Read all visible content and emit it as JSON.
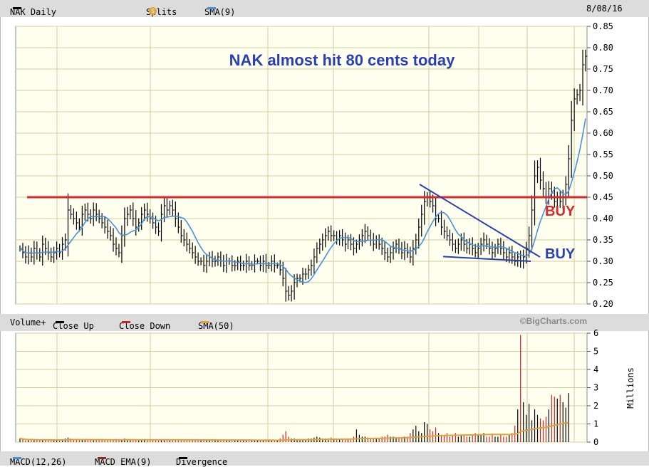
{
  "price_header": {
    "symbol_label": "NAK Daily",
    "splits_label": "Splits",
    "splits_icon": "S",
    "sma_label": "SMA(9)",
    "date_label": "8/08/16"
  },
  "volume_header": {
    "volume_label": "Volume+",
    "close_up_label": "Close Up",
    "close_down_label": "Close Down",
    "sma_label": "SMA(50)"
  },
  "macd_header": {
    "macd_label": "MACD(12,26)",
    "ema_label": "MACD EMA(9)",
    "divergence_label": "Divergence"
  },
  "credit": "©BigCharts.com",
  "colors": {
    "price_bars": "#000000",
    "sma": "#4a90d9",
    "close_up": "#000000",
    "close_down": "#cc2222",
    "volume_sma": "#e0a040",
    "plot_bg": "#fffff0",
    "grid": "#cfcf9a",
    "resistance": "#d8282c",
    "annotation_blue": "#2b3fb4"
  },
  "chart_data": [
    {
      "type": "bar",
      "name": "price",
      "ylim": [
        0.2,
        0.85
      ],
      "ticks": [
        "0.20",
        "0.25",
        "0.30",
        "0.35",
        "0.40",
        "0.45",
        "0.50",
        "0.55",
        "0.60",
        "0.65",
        "0.70",
        "0.75",
        "0.80",
        "0.85"
      ],
      "grid": true,
      "description_keys": [
        "daily OHLC bars",
        "SMA(9)"
      ],
      "close": [
        0.33,
        0.32,
        0.31,
        0.32,
        0.31,
        0.33,
        0.32,
        0.31,
        0.34,
        0.33,
        0.32,
        0.31,
        0.32,
        0.33,
        0.32,
        0.34,
        0.35,
        0.42,
        0.41,
        0.4,
        0.39,
        0.38,
        0.41,
        0.42,
        0.41,
        0.4,
        0.42,
        0.41,
        0.4,
        0.39,
        0.38,
        0.37,
        0.36,
        0.34,
        0.33,
        0.32,
        0.36,
        0.4,
        0.41,
        0.42,
        0.4,
        0.38,
        0.39,
        0.41,
        0.42,
        0.41,
        0.4,
        0.39,
        0.38,
        0.37,
        0.41,
        0.43,
        0.42,
        0.43,
        0.42,
        0.4,
        0.38,
        0.36,
        0.35,
        0.34,
        0.33,
        0.32,
        0.31,
        0.3,
        0.3,
        0.29,
        0.3,
        0.31,
        0.3,
        0.3,
        0.31,
        0.3,
        0.29,
        0.3,
        0.3,
        0.29,
        0.29,
        0.3,
        0.29,
        0.29,
        0.3,
        0.29,
        0.29,
        0.3,
        0.3,
        0.29,
        0.3,
        0.29,
        0.29,
        0.3,
        0.29,
        0.29,
        0.28,
        0.26,
        0.23,
        0.22,
        0.23,
        0.25,
        0.26,
        0.26,
        0.27,
        0.27,
        0.28,
        0.29,
        0.31,
        0.33,
        0.34,
        0.35,
        0.36,
        0.37,
        0.36,
        0.36,
        0.35,
        0.36,
        0.35,
        0.34,
        0.35,
        0.34,
        0.33,
        0.34,
        0.35,
        0.36,
        0.37,
        0.36,
        0.35,
        0.34,
        0.35,
        0.34,
        0.33,
        0.32,
        0.31,
        0.32,
        0.33,
        0.34,
        0.33,
        0.32,
        0.33,
        0.32,
        0.31,
        0.33,
        0.35,
        0.38,
        0.41,
        0.44,
        0.45,
        0.44,
        0.43,
        0.4,
        0.4,
        0.38,
        0.37,
        0.36,
        0.35,
        0.34,
        0.33,
        0.34,
        0.35,
        0.34,
        0.33,
        0.34,
        0.33,
        0.32,
        0.33,
        0.34,
        0.35,
        0.34,
        0.33,
        0.32,
        0.33,
        0.34,
        0.33,
        0.32,
        0.31,
        0.32,
        0.31,
        0.3,
        0.31,
        0.3,
        0.31,
        0.33,
        0.36,
        0.42,
        0.5,
        0.52,
        0.49,
        0.47,
        0.45,
        0.47,
        0.46,
        0.44,
        0.45,
        0.44,
        0.45,
        0.48,
        0.54,
        0.63,
        0.68,
        0.69,
        0.7,
        0.76,
        0.78
      ],
      "sma9_from_close": true,
      "annotations": [
        {
          "type": "text",
          "text": "NAK almost hit 80 cents today",
          "color": "blue"
        },
        {
          "type": "hline",
          "value": 0.45,
          "color": "red"
        },
        {
          "type": "text",
          "text": "BUY",
          "color": "red",
          "near_value": 0.435
        },
        {
          "type": "text",
          "text": "BUY",
          "color": "blue",
          "near_value": 0.34
        },
        {
          "type": "trendline",
          "from": [
            0.48
          ],
          "to": [
            0.31
          ],
          "color": "blue"
        },
        {
          "type": "trendline",
          "from": [
            0.31
          ],
          "to": [
            0.3
          ],
          "color": "blue"
        }
      ]
    },
    {
      "type": "bar",
      "name": "volume",
      "ylabel": "Millions",
      "ylim": [
        0,
        6
      ],
      "ticks": [
        "0",
        "1",
        "2",
        "3",
        "4",
        "5",
        "6"
      ],
      "grid": true,
      "volume_millions_approx": [
        0.2,
        0.15,
        0.1,
        0.1,
        0.15,
        0.1,
        0.1,
        0.1,
        0.15,
        0.1,
        0.1,
        0.1,
        0.1,
        0.1,
        0.1,
        0.15,
        0.2,
        0.25,
        0.2,
        0.15,
        0.15,
        0.1,
        0.15,
        0.15,
        0.1,
        0.15,
        0.1,
        0.1,
        0.15,
        0.1,
        0.1,
        0.1,
        0.1,
        0.15,
        0.1,
        0.1,
        0.15,
        0.2,
        0.15,
        0.15,
        0.1,
        0.1,
        0.1,
        0.15,
        0.15,
        0.1,
        0.1,
        0.1,
        0.1,
        0.1,
        0.15,
        0.15,
        0.1,
        0.15,
        0.1,
        0.1,
        0.1,
        0.1,
        0.1,
        0.1,
        0.1,
        0.1,
        0.1,
        0.1,
        0.1,
        0.1,
        0.1,
        0.1,
        0.1,
        0.1,
        0.1,
        0.1,
        0.1,
        0.1,
        0.1,
        0.1,
        0.1,
        0.1,
        0.1,
        0.1,
        0.1,
        0.1,
        0.1,
        0.1,
        0.1,
        0.1,
        0.1,
        0.1,
        0.1,
        0.1,
        0.1,
        0.1,
        0.2,
        0.4,
        0.6,
        0.3,
        0.2,
        0.2,
        0.15,
        0.15,
        0.15,
        0.15,
        0.2,
        0.2,
        0.25,
        0.3,
        0.25,
        0.2,
        0.2,
        0.2,
        0.25,
        0.2,
        0.2,
        0.2,
        0.15,
        0.15,
        0.2,
        0.2,
        0.3,
        0.7,
        0.4,
        0.3,
        0.3,
        0.25,
        0.2,
        0.2,
        0.2,
        0.2,
        0.3,
        0.3,
        0.4,
        0.3,
        0.3,
        0.2,
        0.2,
        0.2,
        0.3,
        0.3,
        0.5,
        0.7,
        0.9,
        0.6,
        0.5,
        1.1,
        1.0,
        0.7,
        0.6,
        0.8,
        0.5,
        0.4,
        0.4,
        0.5,
        0.3,
        0.4,
        0.5,
        0.3,
        0.4,
        0.4,
        0.3,
        0.3,
        0.4,
        0.5,
        0.4,
        0.4,
        0.5,
        0.3,
        0.3,
        0.4,
        0.3,
        0.3,
        0.4,
        0.3,
        0.3,
        0.4,
        0.5,
        0.9,
        1.8,
        5.9,
        2.2,
        1.5,
        2.1,
        1.2,
        1.8,
        1.5,
        1.3,
        1.2,
        1.4,
        1.8,
        2.6,
        2.5,
        2.4,
        2.6,
        2.2,
        1.9,
        2.7
      ],
      "sma50": true
    }
  ]
}
